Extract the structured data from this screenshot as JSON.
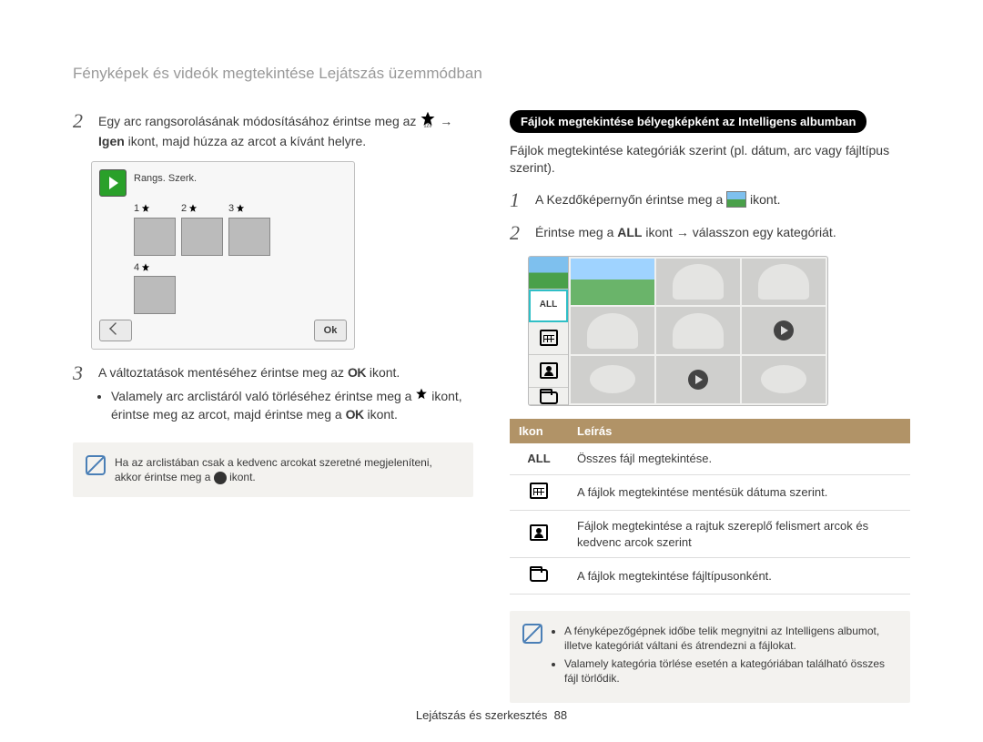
{
  "header": {
    "title": "Fényképek és videók megtekintése Lejátszás üzemmódban"
  },
  "left": {
    "step2_a": "Egy arc rangsorolásának módosításához érintse meg az",
    "step2_b": "→",
    "step2_igen": "Igen",
    "step2_c": "ikont, majd húzza az arcot a kívánt helyre.",
    "cam": {
      "rangs": "Rangs.",
      "szerk": "Szerk.",
      "n1": "1",
      "n2": "2",
      "n3": "3",
      "n4": "4",
      "ok": "Ok"
    },
    "step3_a": "A változtatások mentéséhez érintse meg az",
    "step3_b": "ikont.",
    "bullet1_a": "Valamely arc arclistáról való törléséhez érintse meg a",
    "bullet1_b": "ikont, érintse meg az arcot, majd érintse meg a",
    "bullet1_c": "ikont.",
    "note_a": "Ha az arclistában csak a kedvenc arcokat szeretné megjeleníteni, akkor érintse meg a",
    "note_b": "ikont."
  },
  "right": {
    "pill": "Fájlok megtekintése bélyegképként az Intelligens albumban",
    "intro": "Fájlok megtekintése kategóriák szerint (pl. dátum, arc vagy fájltípus szerint).",
    "step1_a": "A Kezdőképernyőn érintse meg a",
    "step1_b": "ikont.",
    "step2_a": "Érintse meg a",
    "step2_all": "ALL",
    "step2_b": "ikont → válasszon egy kategóriát.",
    "side_all": "ALL",
    "th_icon": "Ikon",
    "th_desc": "Leírás",
    "row_all_icon": "ALL",
    "row_all": "Összes fájl megtekintése.",
    "row_cal": "A fájlok megtekintése mentésük dátuma szerint.",
    "row_face": "Fájlok megtekintése a rajtuk szereplő felismert arcok és kedvenc arcok szerint",
    "row_folder": "A fájlok megtekintése fájltípusonként.",
    "note1": "A fényképezőgépnek időbe telik megnyitni az Intelligens albumot, illetve kategóriát váltani és átrendezni a fájlokat.",
    "note2": "Valamely kategória törlése esetén a kategóriában található összes fájl törlődik."
  },
  "footer": {
    "section": "Lejátszás és szerkesztés",
    "page": "88"
  }
}
